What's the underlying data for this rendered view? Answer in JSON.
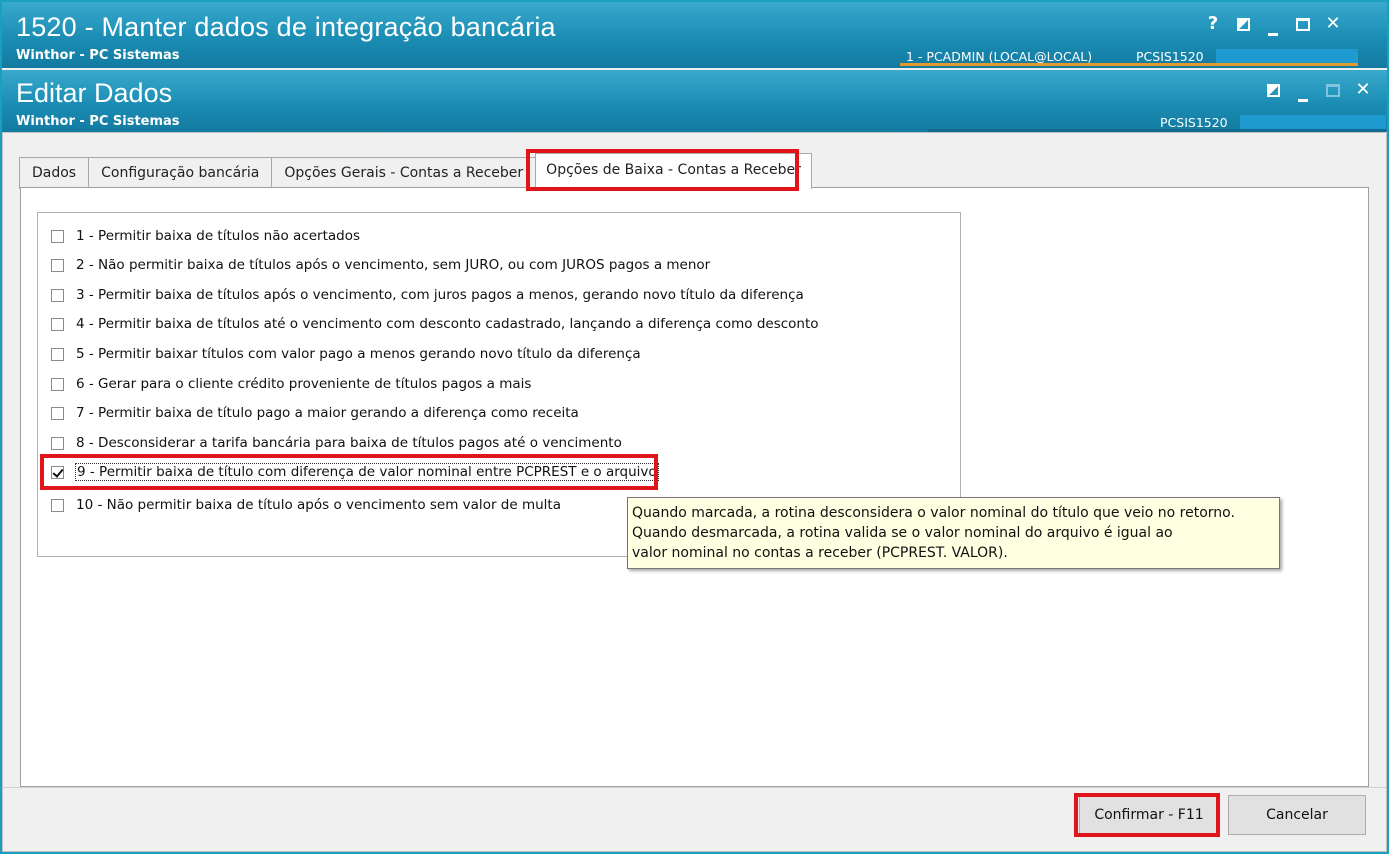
{
  "main_window": {
    "title": "1520 - Manter dados de integração bancária",
    "subtitle": "Winthor - PC Sistemas",
    "user": "1 - PCADMIN (LOCAL@LOCAL)",
    "routine_code": "PCSIS1520",
    "controls": {
      "help": "?",
      "close": "✕"
    }
  },
  "dialog": {
    "title": "Editar Dados",
    "subtitle": "Winthor - PC Sistemas",
    "routine_code": "PCSIS1520",
    "controls": {
      "close": "✕"
    }
  },
  "tabs": [
    {
      "label": "Dados",
      "active": false
    },
    {
      "label": "Configuração bancária",
      "active": false
    },
    {
      "label": "Opções Gerais - Contas a Receber",
      "active": false
    },
    {
      "label": "Opções de Baixa - Contas a Receber",
      "active": true
    }
  ],
  "options": [
    {
      "label": "1 - Permitir baixa de títulos não acertados",
      "checked": false
    },
    {
      "label": "2 - Não permitir baixa de títulos após o vencimento, sem JURO, ou com JUROS pagos a menor",
      "checked": false
    },
    {
      "label": "3 - Permitir baixa de títulos após o vencimento, com juros pagos a menos, gerando novo título da diferença",
      "checked": false
    },
    {
      "label": "4 - Permitir baixa de títulos até o vencimento com desconto cadastrado, lançando a diferença como desconto",
      "checked": false
    },
    {
      "label": "5 - Permitir baixar títulos com valor pago a menos gerando novo título da diferença",
      "checked": false
    },
    {
      "label": "6 - Gerar para o cliente crédito proveniente de títulos pagos a mais",
      "checked": false
    },
    {
      "label": "7 - Permitir baixa de título pago a maior gerando a diferença como receita",
      "checked": false
    },
    {
      "label": "8 - Desconsiderar a tarifa bancária para baixa de títulos pagos até o vencimento",
      "checked": false
    },
    {
      "label": "9 - Permitir baixa de título com diferença de valor nominal entre PCPREST e o arquivo",
      "checked": true
    },
    {
      "label": "10 - Não permitir baixa de título após o vencimento sem valor de multa",
      "checked": false
    }
  ],
  "tooltip": {
    "lines": [
      "Quando marcada, a rotina desconsidera o valor nominal do título que veio no retorno.",
      "Quando desmarcada, a rotina valida se o valor nominal do arquivo é igual ao",
      "valor nominal no contas a receber (PCPREST. VALOR)."
    ]
  },
  "buttons": {
    "confirm": "Confirmar - F11",
    "cancel": "Cancelar"
  },
  "colors": {
    "titlebar": "#1b8db4",
    "highlight": "#e1141b",
    "tooltip_bg": "#ffffe1"
  }
}
